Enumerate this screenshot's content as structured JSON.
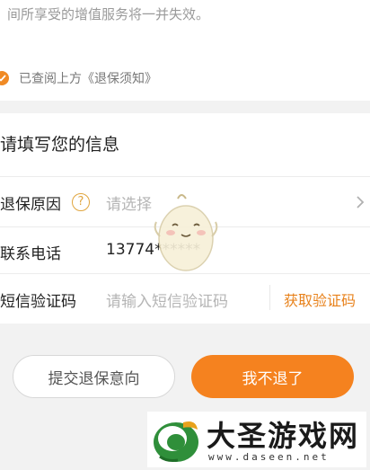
{
  "notice": {
    "text": "间所享受的增值服务将一并失效。",
    "agree_text": "已查阅上方《退保须知》",
    "agree_checked": true
  },
  "form": {
    "section_title": "请填写您的信息",
    "reason": {
      "label": "退保原因",
      "placeholder": "请选择",
      "help_icon": "question-circle-icon",
      "arrow_icon": "chevron-right-icon"
    },
    "phone": {
      "label": "联系电话",
      "value": "13774******"
    },
    "sms": {
      "label": "短信验证码",
      "placeholder": "请输入短信验证码",
      "get_code": "获取验证码"
    }
  },
  "buttons": {
    "submit": "提交退保意向",
    "keep": "我不退了"
  },
  "watermark": {
    "title": "大圣游戏网",
    "url": "www.daseen.net"
  },
  "colors": {
    "accent": "#f5821f",
    "link": "#e8821c",
    "background": "#f2f2f2",
    "card": "#ffffff"
  }
}
